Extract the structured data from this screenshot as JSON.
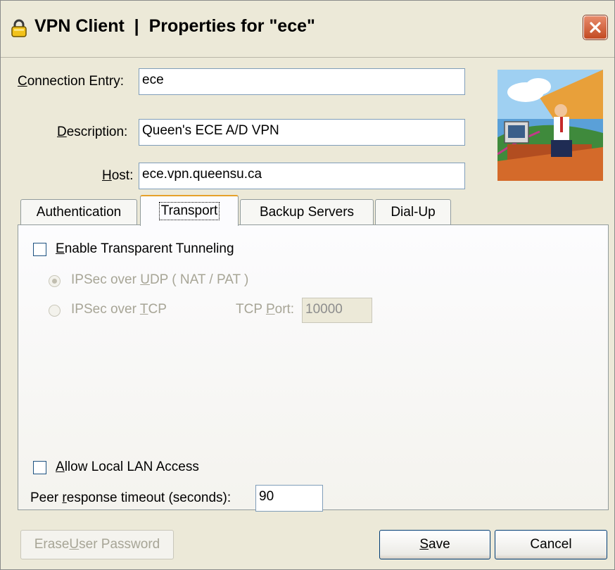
{
  "window": {
    "title": "VPN Client  |  Properties for \"ece\"",
    "title_icon": "padlock-icon",
    "close_icon": "close-icon"
  },
  "fields": {
    "connection_entry": {
      "label_pre": "",
      "label_u": "C",
      "label_post": "onnection Entry:",
      "value": "ece"
    },
    "description": {
      "label_pre": "",
      "label_u": "D",
      "label_post": "escription:",
      "value": "Queen's ECE A/D VPN"
    },
    "host": {
      "label_pre": "",
      "label_u": "H",
      "label_post": "ost:",
      "value": "ece.vpn.queensu.ca"
    }
  },
  "illustration_icon": "vpn-user-computer-illustration",
  "tabs": [
    {
      "label": "Authentication",
      "active": false
    },
    {
      "label": "Transport",
      "active": true
    },
    {
      "label": "Backup Servers",
      "active": false
    },
    {
      "label": "Dial-Up",
      "active": false
    }
  ],
  "transport": {
    "enable_tunneling": {
      "label_pre": "",
      "label_u": "E",
      "label_post": "nable Transparent Tunneling",
      "checked": false
    },
    "udp": {
      "label_pre": "IPSec over ",
      "label_u": "U",
      "label_post": "DP ( NAT / PAT )",
      "selected": true,
      "enabled": false
    },
    "tcp": {
      "label_pre": "IPSec over ",
      "label_u": "T",
      "label_post": "CP",
      "selected": false,
      "enabled": false
    },
    "tcp_port": {
      "label_pre": "TCP ",
      "label_u": "P",
      "label_post": "ort:",
      "value": "10000"
    },
    "allow_lan": {
      "label_pre": "",
      "label_u": "A",
      "label_post": "llow Local LAN Access",
      "checked": false
    },
    "peer_timeout": {
      "label_pre": "Peer ",
      "label_u": "r",
      "label_post": "esponse timeout (seconds):",
      "value": "90"
    }
  },
  "buttons": {
    "erase": {
      "label_pre": "Erase ",
      "label_u": "U",
      "label_post": "ser Password",
      "enabled": false
    },
    "save": {
      "label_pre": "",
      "label_u": "S",
      "label_post": "ave"
    },
    "cancel": {
      "label": "Cancel"
    }
  }
}
